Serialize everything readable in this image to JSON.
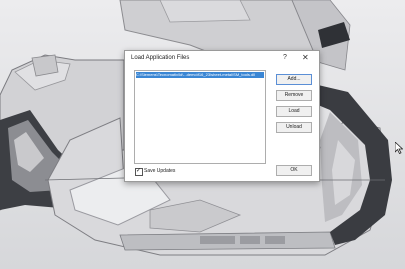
{
  "dialog": {
    "title": "Load Application Files",
    "help_label": "?",
    "close_label": "✕",
    "files": [
      "C:\\Siemens\\Tecnomatix\\ld\\...demo\\f16_23\\sheet-metal\\SM_tools.dll"
    ],
    "buttons": {
      "add": "Add...",
      "remove": "Remove",
      "load": "Load",
      "unload": "Unload",
      "ok": "OK"
    },
    "save_updates": {
      "label": "Save Updates",
      "checked": true
    }
  },
  "colors": {
    "selection": "#3a86d4",
    "model_surface": "#d4d4d6",
    "model_dark": "#3d3f44"
  },
  "icons": [
    "mouse-cursor-icon",
    "checkmark-icon"
  ]
}
